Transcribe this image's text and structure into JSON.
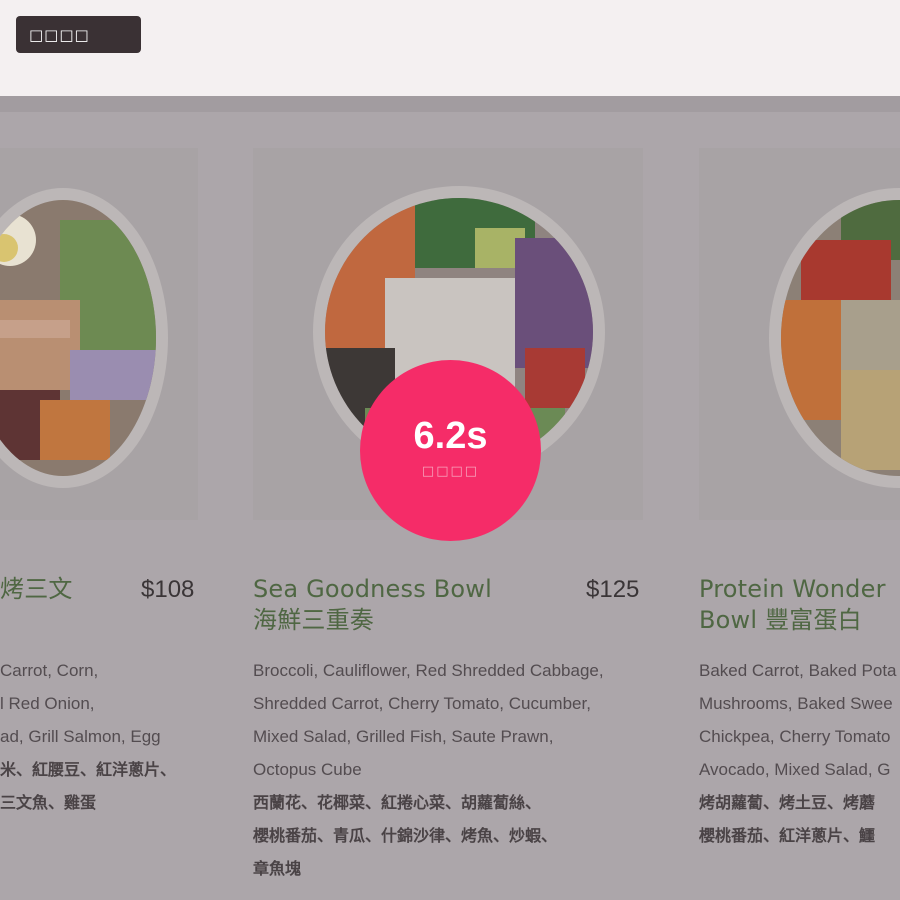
{
  "toolbar": {
    "button_label": "□□□□"
  },
  "timer": {
    "value": "6.2s",
    "label": "□□□□"
  },
  "cards": [
    {
      "title": "烤三文",
      "price": "$108",
      "desc": [
        "Carrot, Corn,",
        "l Red Onion,",
        "ad, Grill Salmon, Egg"
      ],
      "desc_zh": [
        "米、紅腰豆、紅洋蔥片、",
        "三文魚、雞蛋"
      ]
    },
    {
      "title": "Sea Goodness Bowl",
      "title_zh": "海鮮三重奏",
      "price": "$125",
      "desc": [
        "Broccoli, Cauliflower, Red Shredded Cabbage,",
        "Shredded Carrot, Cherry Tomato, Cucumber,",
        "Mixed Salad, Grilled Fish, Saute Prawn,",
        "Octopus Cube"
      ],
      "desc_zh": [
        "西蘭花、花椰菜、紅捲心菜、胡蘿蔔絲、",
        "櫻桃番茄、青瓜、什錦沙律、烤魚、炒蝦、",
        "章魚塊"
      ]
    },
    {
      "title": "Protein Wonder",
      "title_zh": "Bowl 豐富蛋白",
      "desc": [
        "Baked Carrot, Baked Pota",
        "Mushrooms, Baked Swee",
        "Chickpea, Cherry Tomato",
        "Avocado, Mixed Salad, G"
      ],
      "desc_zh": [
        "烤胡蘿蔔、烤土豆、烤蘑",
        "櫻桃番茄、紅洋蔥片、鱷"
      ]
    }
  ]
}
